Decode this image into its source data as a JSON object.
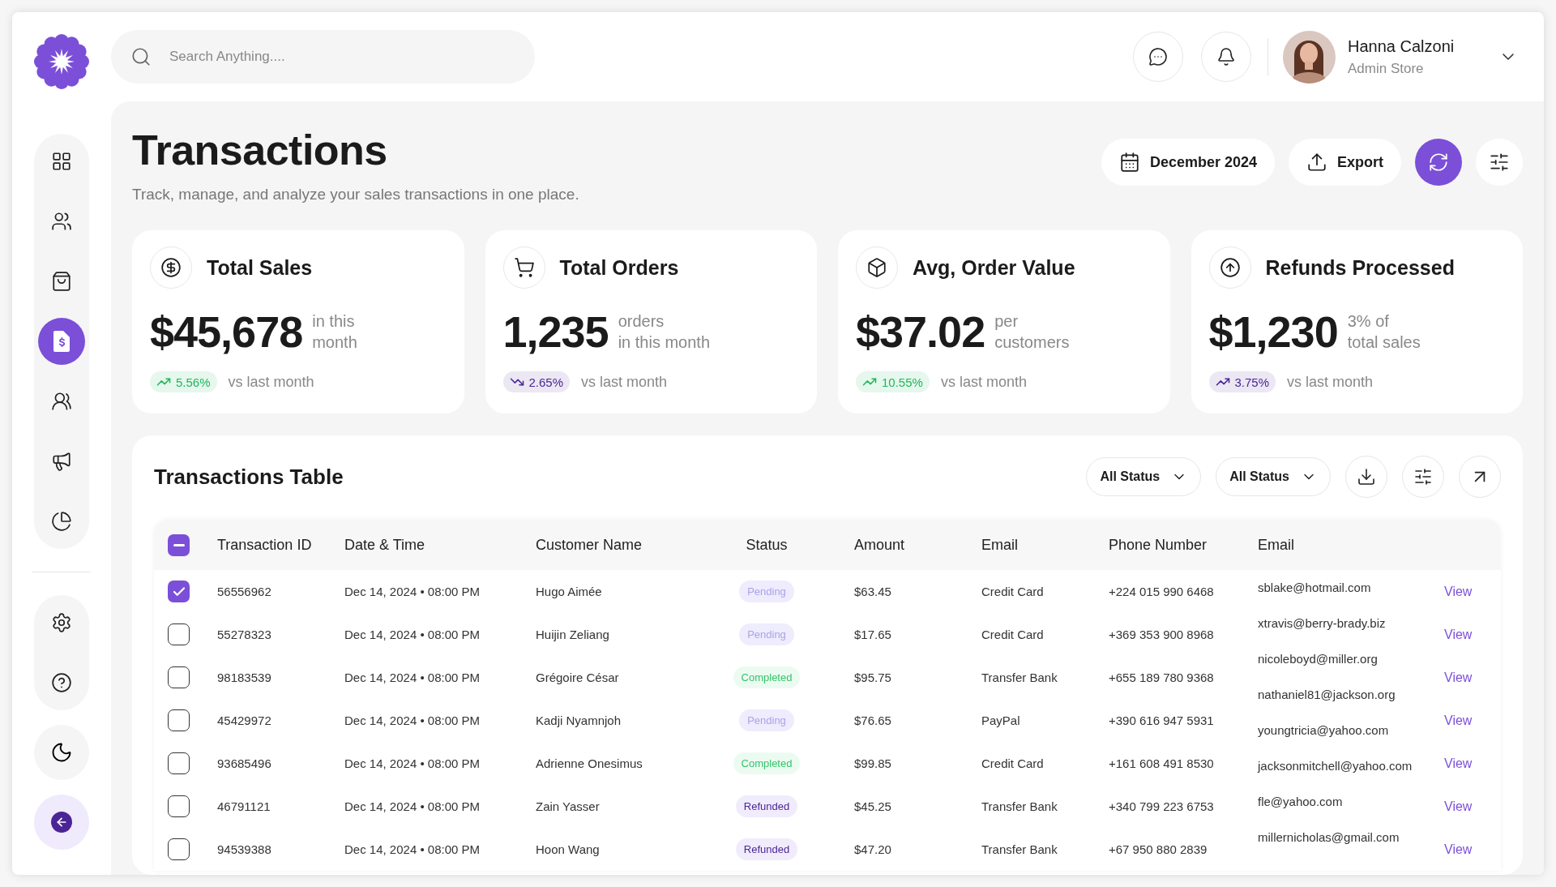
{
  "sidebar": {
    "items": [
      {
        "kind": "dashboard",
        "selected": false
      },
      {
        "kind": "users",
        "selected": false
      },
      {
        "kind": "bag",
        "selected": false
      },
      {
        "kind": "invoice",
        "selected": true
      },
      {
        "kind": "group",
        "selected": false
      },
      {
        "kind": "megaphone",
        "selected": false
      },
      {
        "kind": "chart",
        "selected": false
      }
    ],
    "bottom_items": [
      {
        "kind": "settings",
        "selected": false
      },
      {
        "kind": "help",
        "selected": false
      }
    ]
  },
  "header": {
    "search": {
      "placeholder": "Search Anything...."
    },
    "user": {
      "name": "Hanna Calzoni",
      "role": "Admin Store"
    }
  },
  "page": {
    "title": "Transactions",
    "subtitle": "Track, manage, and analyze your sales transactions in one place.",
    "date_button": "December 2024",
    "export_button": "Export"
  },
  "stats": [
    {
      "kind": "dollar",
      "title": "Total Sales",
      "value": "$45,678",
      "note_lines": [
        "in this",
        "month"
      ],
      "trend": {
        "kind": "up",
        "value": "5.56%",
        "color": "#1fb85a"
      },
      "comparison": "vs last month"
    },
    {
      "kind": "cart",
      "title": "Total Orders",
      "value": "1,235",
      "note_lines": [
        "orders",
        "in this month"
      ],
      "trend": {
        "kind": "down",
        "value": "2.65%",
        "color": "#4b2596"
      },
      "comparison": "vs last month"
    },
    {
      "kind": "box",
      "title": "Avg, Order Value",
      "value": "$37.02",
      "note_lines": [
        "per",
        "customers"
      ],
      "trend": {
        "kind": "up",
        "value": "10.55%",
        "color": "#1fb85a"
      },
      "comparison": "vs last month"
    },
    {
      "kind": "refund",
      "title": "Refunds Processed",
      "value": "$1,230",
      "note_lines": [
        "3% of",
        "total sales"
      ],
      "trend": {
        "kind": "up",
        "value": "3.75%",
        "color": "#4b2596"
      },
      "comparison": "vs last month"
    }
  ],
  "table": {
    "title": "Transactions Table",
    "filters": [
      "All Status",
      "All Status"
    ],
    "header_checkbox": {
      "indeterminate": true
    },
    "columns": [
      "Transaction ID",
      "Date & Time",
      "Customer Name",
      "Status",
      "Amount",
      "Email",
      "Phone Number",
      "Email"
    ],
    "rows": [
      {
        "checked": true,
        "id": "56556962",
        "datetime": "Dec 14, 2024 • 08:00 PM",
        "customer": "Hugo Aimée",
        "status": {
          "label": "Pending",
          "kind": "pending"
        },
        "amount": "$63.45",
        "method": "Credit Card",
        "phone": "+224 015 990 6468",
        "action": "View"
      },
      {
        "checked": false,
        "id": "55278323",
        "datetime": "Dec 14, 2024 • 08:00 PM",
        "customer": "Huijin Zeliang",
        "status": {
          "label": "Pending",
          "kind": "pending"
        },
        "amount": "$17.65",
        "method": "Credit Card",
        "phone": "+369 353 900 8968",
        "action": "View"
      },
      {
        "checked": false,
        "id": "98183539",
        "datetime": "Dec 14, 2024 • 08:00 PM",
        "customer": "Grégoire César",
        "status": {
          "label": "Completed",
          "kind": "completed"
        },
        "amount": "$95.75",
        "method": "Transfer Bank",
        "phone": "+655 189 780 9368",
        "action": "View"
      },
      {
        "checked": false,
        "id": "45429972",
        "datetime": "Dec 14, 2024 • 08:00 PM",
        "customer": "Kadji Nyamnjoh",
        "status": {
          "label": "Pending",
          "kind": "pending"
        },
        "amount": "$76.65",
        "method": "PayPal",
        "phone": "+390 616 947 5931",
        "action": "View"
      },
      {
        "checked": false,
        "id": "93685496",
        "datetime": "Dec 14, 2024 • 08:00 PM",
        "customer": "Adrienne Onesimus",
        "status": {
          "label": "Completed",
          "kind": "completed"
        },
        "amount": "$99.85",
        "method": "Credit Card",
        "phone": "+161 608 491 8530",
        "action": "View"
      },
      {
        "checked": false,
        "id": "46791121",
        "datetime": "Dec 14, 2024 • 08:00 PM",
        "customer": "Zain Yasser",
        "status": {
          "label": "Refunded",
          "kind": "refunded"
        },
        "amount": "$45.25",
        "method": "Transfer Bank",
        "phone": "+340 799 223 6753",
        "action": "View"
      },
      {
        "checked": false,
        "id": "94539388",
        "datetime": "Dec 14, 2024 • 08:00 PM",
        "customer": "Hoon Wang",
        "status": {
          "label": "Refunded",
          "kind": "refunded"
        },
        "amount": "$47.20",
        "method": "Transfer Bank",
        "phone": "+67 950 880 2839",
        "action": "View"
      }
    ],
    "emails": [
      "sblake@hotmail.com",
      "xtravis@berry-brady.biz",
      "nicoleboyd@miller.org",
      "nathaniel81@jackson.org",
      "youngtricia@yahoo.com",
      "jacksonmitchell@yahoo.com",
      "fle@yahoo.com",
      "millernicholas@gmail.com"
    ]
  }
}
